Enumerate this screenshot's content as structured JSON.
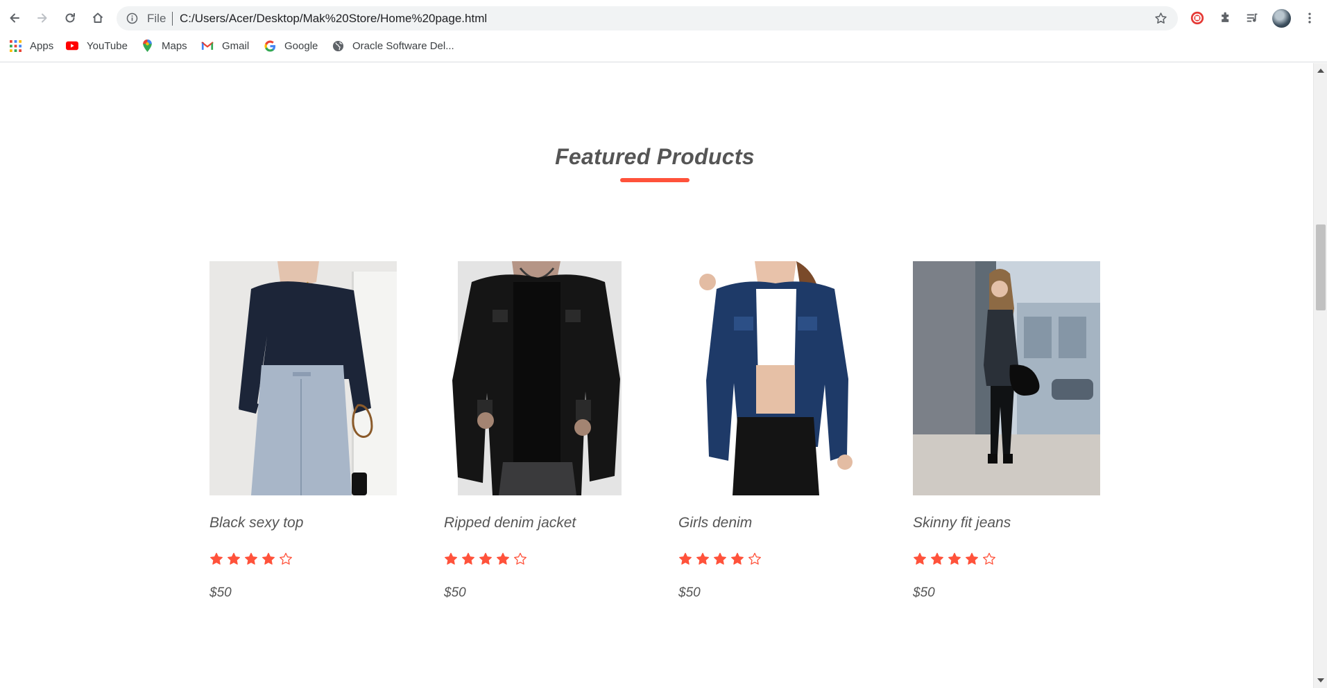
{
  "browser": {
    "omnibox": {
      "scheme_label": "File",
      "url": "C:/Users/Acer/Desktop/Mak%20Store/Home%20page.html"
    },
    "bookmarks": [
      {
        "label": "Apps",
        "icon": "apps-grid-icon"
      },
      {
        "label": "YouTube",
        "icon": "youtube-icon"
      },
      {
        "label": "Maps",
        "icon": "maps-pin-icon"
      },
      {
        "label": "Gmail",
        "icon": "gmail-icon"
      },
      {
        "label": "Google",
        "icon": "google-g-icon"
      },
      {
        "label": "Oracle Software Del...",
        "icon": "globe-icon"
      }
    ]
  },
  "section": {
    "title": "Featured Products",
    "accent_color": "#ff523b"
  },
  "products": [
    {
      "name": "Black sexy top",
      "price": "$50",
      "rating": 4,
      "rating_max": 5
    },
    {
      "name": "Ripped denim jacket",
      "price": "$50",
      "rating": 4,
      "rating_max": 5
    },
    {
      "name": "Girls denim",
      "price": "$50",
      "rating": 4,
      "rating_max": 5
    },
    {
      "name": "Skinny fit jeans",
      "price": "$50",
      "rating": 4,
      "rating_max": 5
    }
  ]
}
